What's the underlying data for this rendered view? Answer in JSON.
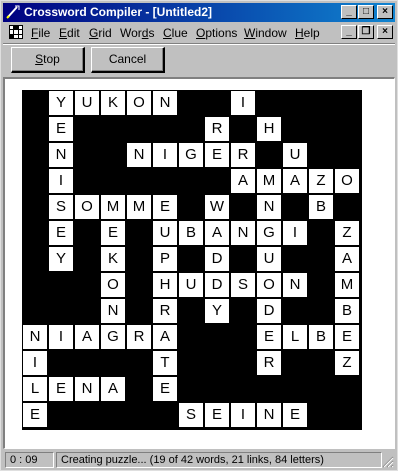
{
  "window": {
    "title": "Crossword Compiler - [Untitled2]",
    "controls": {
      "minimize": "_",
      "maximize": "□",
      "close": "×"
    },
    "mdi_controls": {
      "minimize": "_",
      "restore": "❐",
      "close": "×"
    }
  },
  "menu": {
    "items": [
      {
        "key": "F",
        "rest": "ile"
      },
      {
        "key": "E",
        "rest": "dit"
      },
      {
        "key": "G",
        "rest": "rid"
      },
      {
        "pre": "Wor",
        "key": "d",
        "rest": "s"
      },
      {
        "key": "C",
        "rest": "lue"
      },
      {
        "key": "O",
        "rest": "ptions"
      },
      {
        "key": "W",
        "rest": "indow"
      },
      {
        "key": "H",
        "rest": "elp"
      }
    ]
  },
  "toolbar": {
    "stop_key": "S",
    "stop_rest": "top",
    "cancel_label": "Cancel"
  },
  "grid": {
    "size": 13,
    "rows": [
      "#YUKON##I####",
      "#E#####R#H###",
      "#N##NIGER#U##",
      "#I######AMAZON",
      "#SOMME#W#N#B#",
      "#E#E#UBANGI#Z",
      "#Y#K#P#D#U##A",
      "###O#HUDSON#M",
      "###N#R#Y#D##B",
      "NIAGRA###ELBE",
      "I####T###R##Z",
      "LENA#E#######",
      "E#####SEINE##"
    ]
  },
  "status": {
    "timer": "0 : 09",
    "message": "Creating puzzle... (19 of 42 words, 21 links, 84 letters)"
  }
}
